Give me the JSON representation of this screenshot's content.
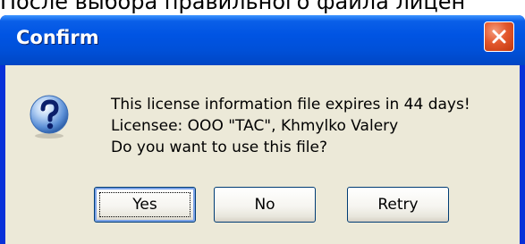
{
  "background_caption": "После выбора правильного файла лицен",
  "dialog": {
    "title": "Confirm",
    "icon": "question-icon",
    "message_lines": [
      "This license information file expires in 44 days!",
      "Licensee: OOO \"TAC\", Khmylko Valery",
      "Do you want to use this file?"
    ],
    "buttons": {
      "yes": "Yes",
      "no": "No",
      "retry": "Retry"
    }
  },
  "colors": {
    "titlebar": "#0054e3",
    "frame": "#0831d9",
    "client": "#ece9d8",
    "close_button": "#e3582d",
    "button_border": "#003c74"
  }
}
